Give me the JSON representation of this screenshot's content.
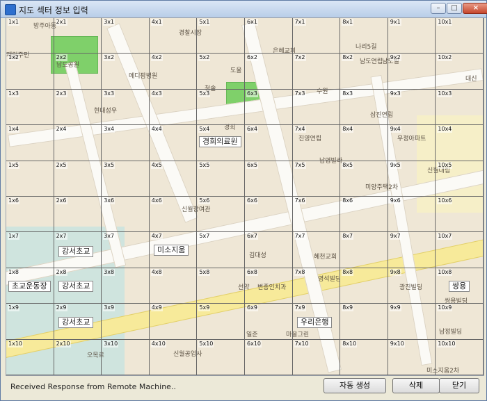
{
  "window": {
    "title": "지도 섹터 정보 입력",
    "minimize": "–",
    "maximize": "□",
    "close": "×"
  },
  "map": {
    "area_labels": [
      "방주아동",
      "경찰시장",
      "은혜교회",
      "나리5길",
      "남도빌",
      "대신",
      "재림주민",
      "남도공원",
      "메디팜병원",
      "도울",
      "남도연립",
      "현대성우",
      "청솔",
      "수원",
      "경희",
      "삼진연립",
      "진영연립",
      "우정아파트",
      "남영빌라",
      "신월대림",
      "미양주택2차",
      "신월장여관",
      "김대성",
      "혜천교회",
      "영석빌딩",
      "선약",
      "변종인치과",
      "광진빌딩",
      "쌍용빌딩",
      "일준",
      "마을그린",
      "남정빌딩",
      "신월공업사",
      "미소지움2차",
      "오목로"
    ],
    "place_labels": [
      "경희의료원",
      "강서초교",
      "미소지움",
      "초교운동장",
      "강서초교",
      "강서초교",
      "우리은행",
      "쌍용"
    ]
  },
  "grid": {
    "cols": 10,
    "rows": 10,
    "cells": [
      [
        "1x1",
        "2x1",
        "3x1",
        "4x1",
        "5x1",
        "6x1",
        "7x1",
        "8x1",
        "9x1",
        "10x1"
      ],
      [
        "1x2",
        "2x2",
        "3x2",
        "4x2",
        "5x2",
        "6x2",
        "7x2",
        "8x2",
        "9x2",
        "10x2"
      ],
      [
        "1x3",
        "2x3",
        "3x3",
        "4x3",
        "5x3",
        "6x3",
        "7x3",
        "8x3",
        "9x3",
        "10x3"
      ],
      [
        "1x4",
        "2x4",
        "3x4",
        "4x4",
        "5x4",
        "6x4",
        "7x4",
        "8x4",
        "9x4",
        "10x4"
      ],
      [
        "1x5",
        "2x5",
        "3x5",
        "4x5",
        "5x5",
        "6x5",
        "7x5",
        "8x5",
        "9x5",
        "10x5"
      ],
      [
        "1x6",
        "2x6",
        "3x6",
        "4x6",
        "5x6",
        "6x6",
        "7x6",
        "8x6",
        "9x6",
        "10x6"
      ],
      [
        "1x7",
        "2x7",
        "3x7",
        "4x7",
        "5x7",
        "6x7",
        "7x7",
        "8x7",
        "9x7",
        "10x7"
      ],
      [
        "1x8",
        "2x8",
        "3x8",
        "4x8",
        "5x8",
        "6x8",
        "7x8",
        "8x8",
        "9x8",
        "10x8"
      ],
      [
        "1x9",
        "2x9",
        "3x9",
        "4x9",
        "5x9",
        "6x9",
        "7x9",
        "8x9",
        "9x9",
        "10x9"
      ],
      [
        "1x10",
        "2x10",
        "3x10",
        "4x10",
        "5x10",
        "6x10",
        "7x10",
        "8x10",
        "9x10",
        "10x10"
      ]
    ]
  },
  "status": "Received Response from Remote Machine..",
  "buttons": {
    "auto": "자동 생성",
    "delete": "삭제",
    "close": "닫기"
  }
}
